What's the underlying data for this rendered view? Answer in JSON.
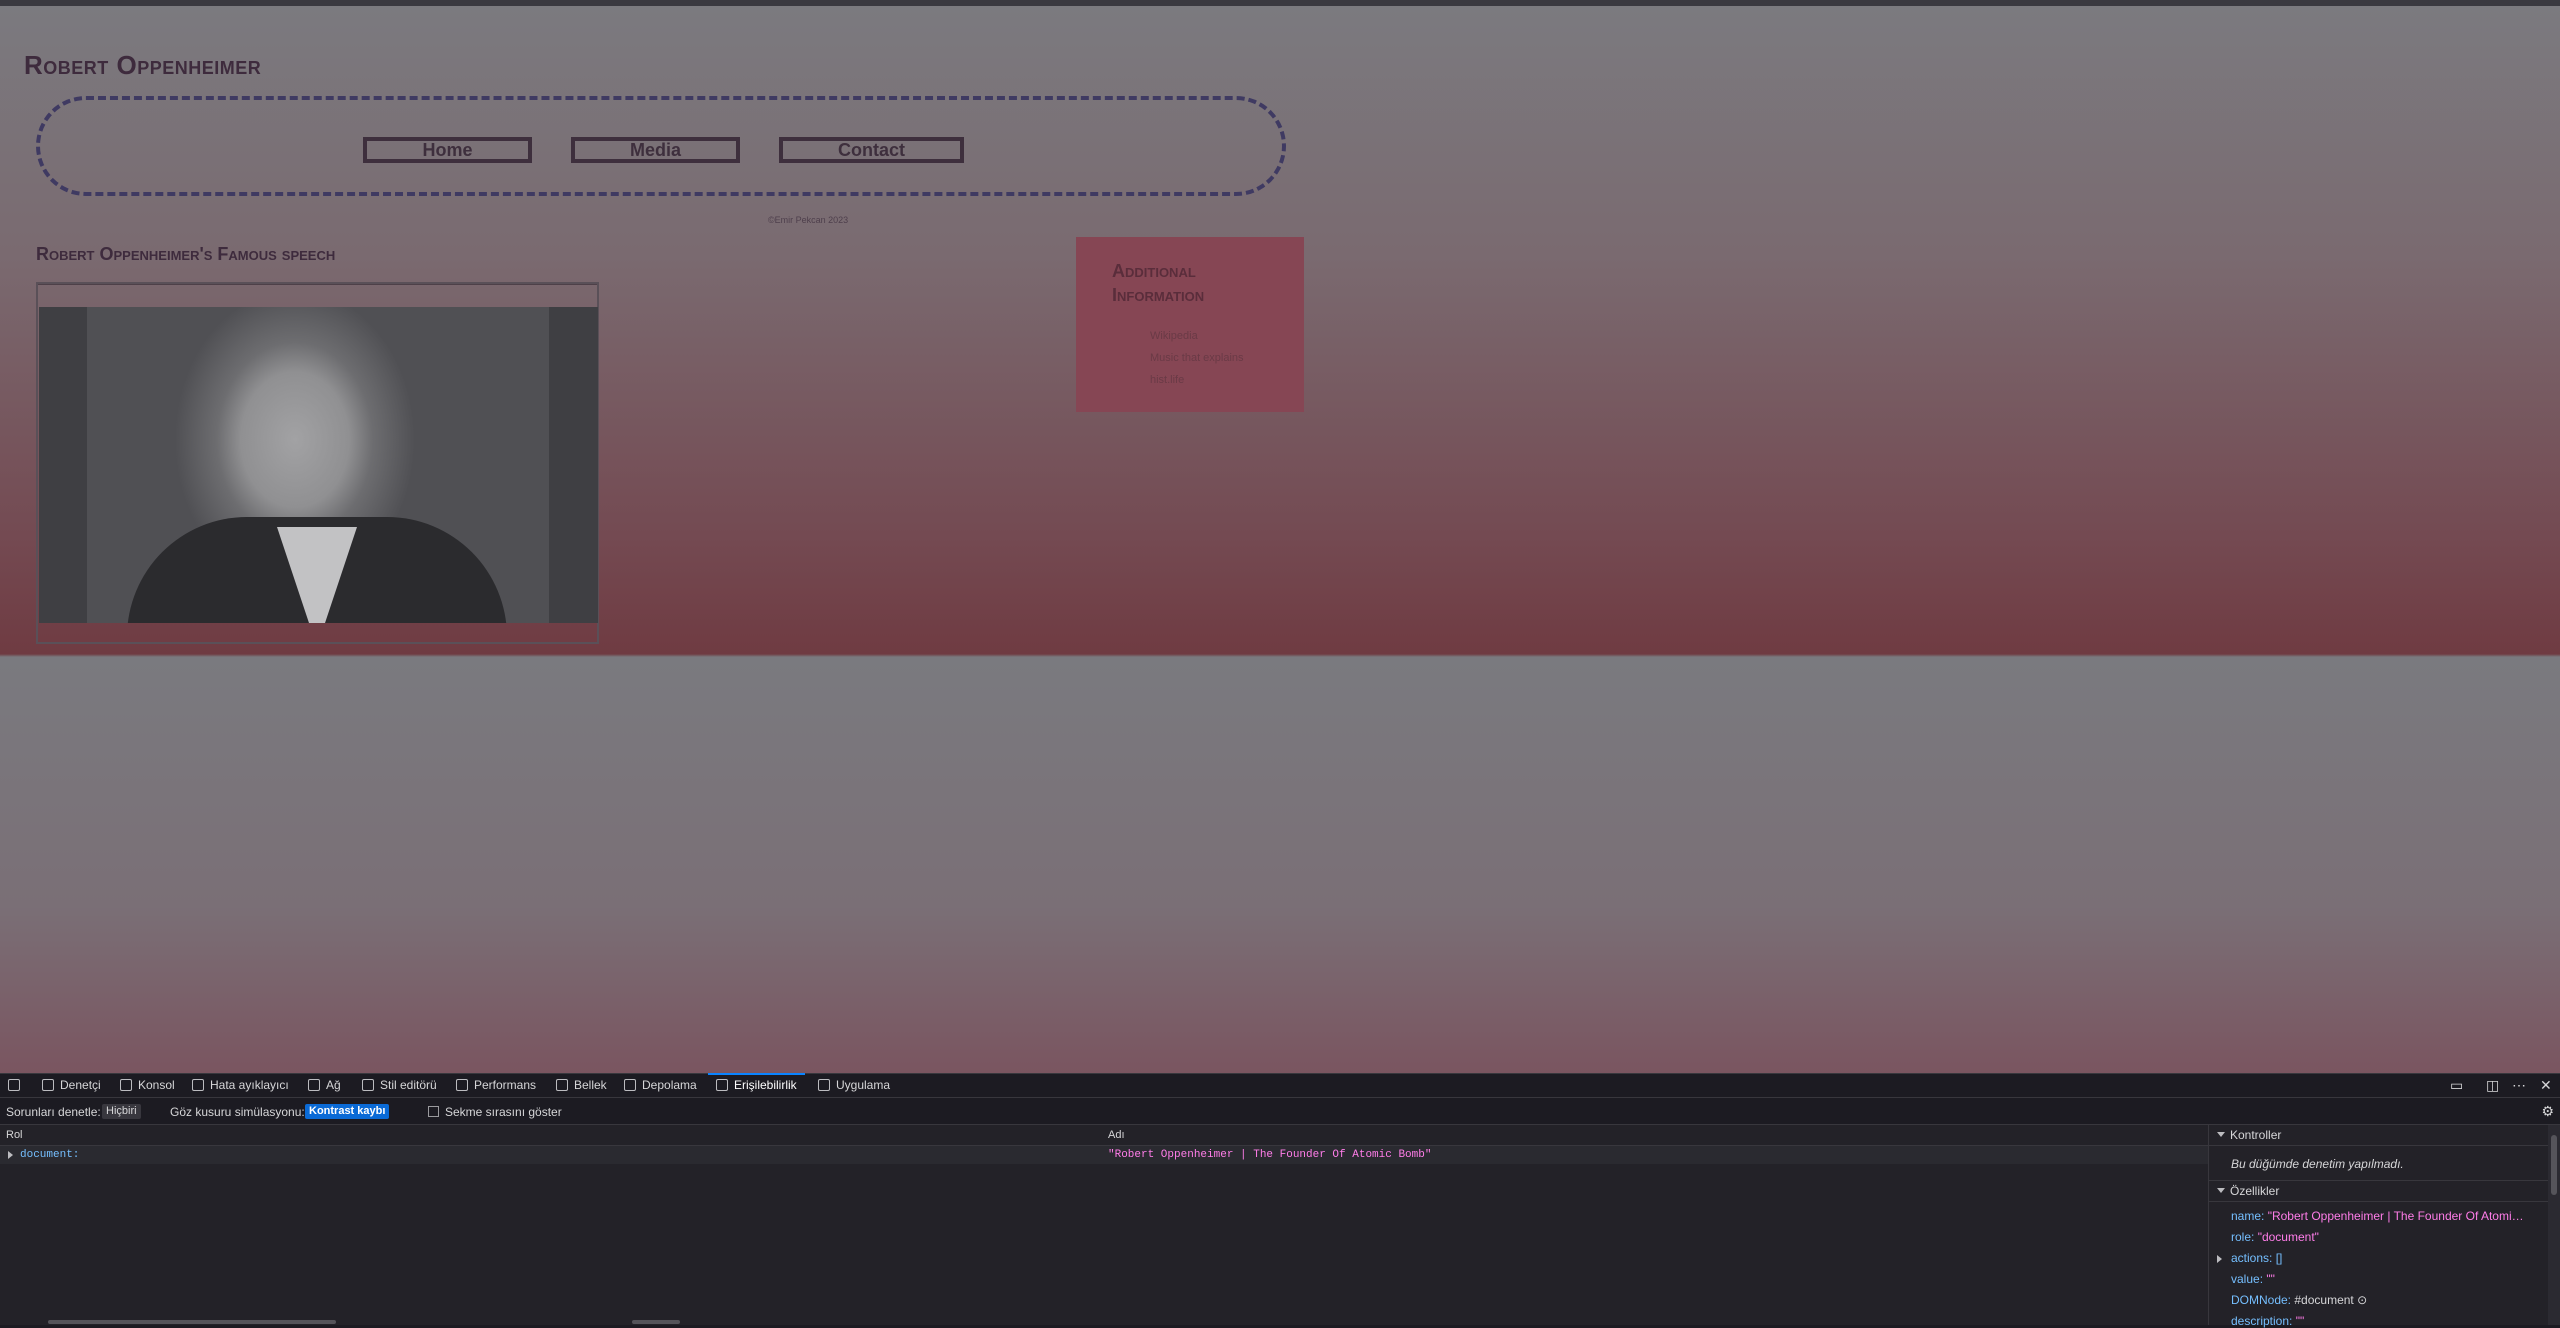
{
  "page": {
    "site_title": "Robert Oppenheimer",
    "nav": [
      {
        "label": "Home"
      },
      {
        "label": "Media"
      },
      {
        "label": "Contact"
      }
    ],
    "copyright": "©Emir Pekcan 2023",
    "speech_title": "Robert Oppenheimer's Famous speech",
    "aside": {
      "title": "Additional Information",
      "links": [
        "Wikipedia",
        "Music that explains",
        "hist.life"
      ]
    }
  },
  "devtools": {
    "tabs": [
      "Denetçi",
      "Konsol",
      "Hata ayıklayıcı",
      "Ağ",
      "Stil editörü",
      "Performans",
      "Bellek",
      "Depolama",
      "Erişilebilirlik",
      "Uygulama"
    ],
    "active_tab": "Erişilebilirlik",
    "toolbar": {
      "issues_label": "Sorunları denetle:",
      "issues_value": "Hiçbiri",
      "simulation_label": "Göz kusuru simülasyonu:",
      "simulation_value": "Kontrast kaybı",
      "tab_order_label": "Sekme sırasını göster"
    },
    "tree": {
      "col_role": "Rol",
      "col_name": "Adı",
      "row_role": "document:",
      "row_name": "\"Robert Oppenheimer | The Founder Of Atomic Bomb\""
    },
    "sidebar": {
      "checks_title": "Kontroller",
      "checks_note": "Bu düğümde denetim yapılmadı.",
      "props_title": "Özellikler",
      "props": [
        {
          "key": "name:",
          "value": "\"Robert Oppenheimer | The Founder Of Atomi…"
        },
        {
          "key": "role:",
          "value": "\"document\""
        },
        {
          "key": "actions:",
          "value": "[]"
        },
        {
          "key": "value:",
          "value": "\"\""
        },
        {
          "key": "DOMNode:",
          "value": "#document"
        },
        {
          "key": "description:",
          "value": "\"\""
        }
      ]
    }
  }
}
